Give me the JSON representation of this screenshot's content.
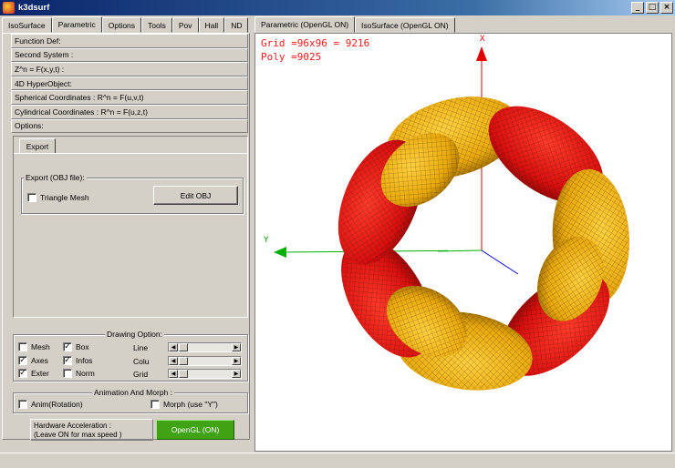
{
  "window": {
    "title": "k3dsurf"
  },
  "left_tabs": [
    "IsoSurface",
    "Parametric",
    "Options",
    "Tools",
    "Pov",
    "Hall",
    "ND"
  ],
  "right_tabs": [
    "Parametric (OpenGL ON)",
    "IsoSurface (OpenGL ON)"
  ],
  "sections": [
    "Function Def:",
    "Second System :",
    "Z^n = F(x,y,t) :",
    "4D HyperObject:",
    "Spherical Coordinates : R^n = F(u,v,t)",
    "Cylindrical Coordinates : R^n = F(u,z,t)",
    "Options:"
  ],
  "options": {
    "export_tab": "Export",
    "export_group": "Export (OBJ file):",
    "triangle_mesh": "Triangle Mesh",
    "edit_obj": "Edit OBJ"
  },
  "drawing": {
    "title": "Drawing Option:",
    "mesh": "Mesh",
    "box": "Box",
    "axes": "Axes",
    "infos": "Infos",
    "exter": "Exter",
    "norm": "Norm",
    "line": "Line",
    "colu": "Colu",
    "grid": "Grid"
  },
  "anim": {
    "title": "Animation And Morph :",
    "rotation": "Anim(Rotation)",
    "morph": "Morph (use \"Y\")"
  },
  "hardware": {
    "line1": "Hardware Acceleration :",
    "line2": "(Leave ON for max speed )",
    "button": "OpenGL (ON)"
  },
  "viewport": {
    "grid_text": "Grid =96x96 = 9216",
    "poly_text": "Poly =9025",
    "axis_x": "X",
    "axis_y": "Y"
  }
}
